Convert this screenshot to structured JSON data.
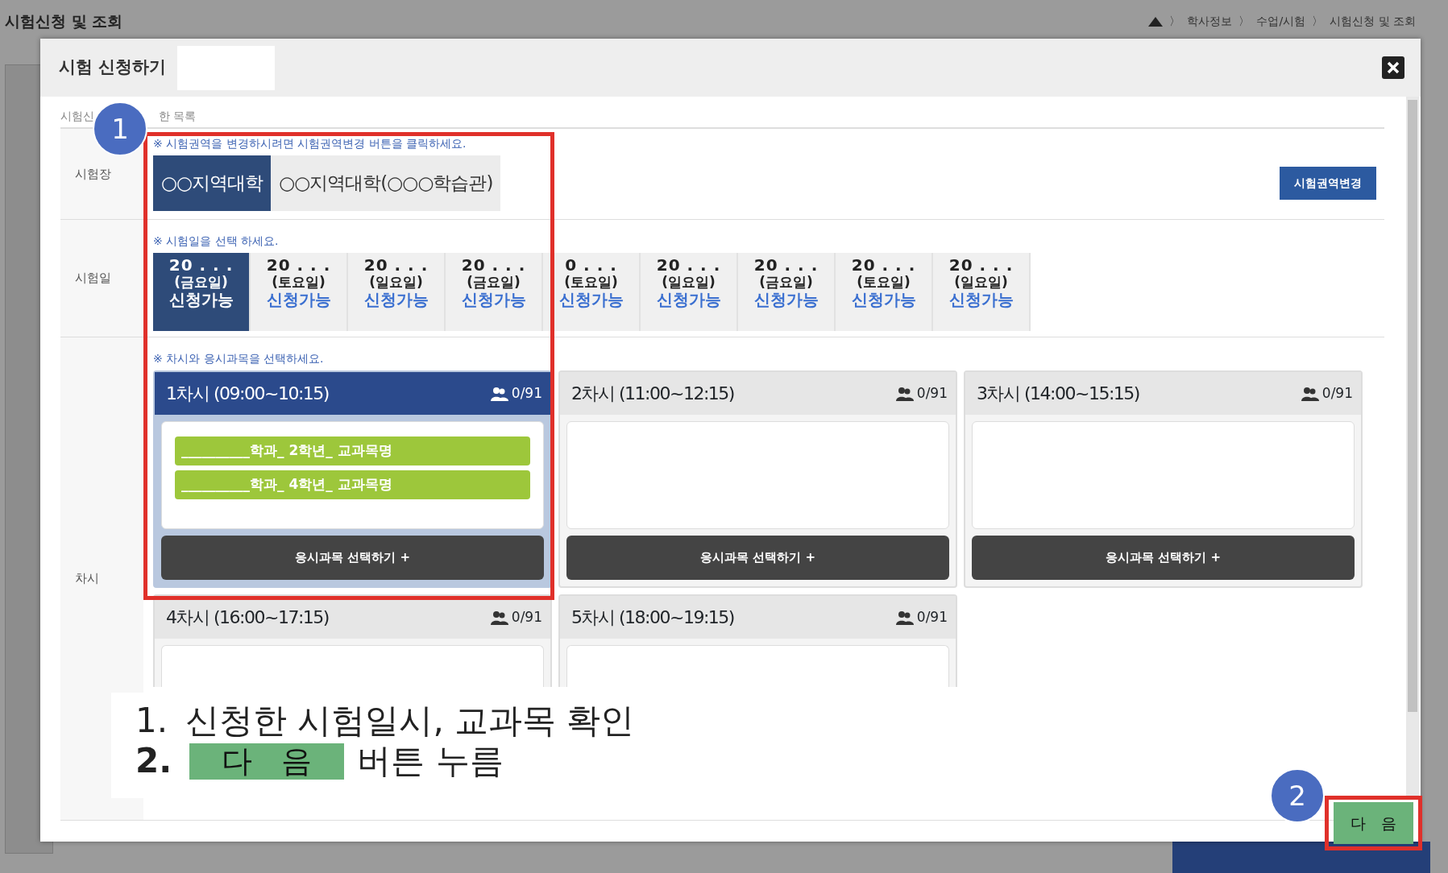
{
  "background_page": {
    "title": "시험신청 및 조회",
    "breadcrumb": [
      "학사정보",
      "수업/시험",
      "시험신청 및 조회"
    ],
    "separator": "〉"
  },
  "modal": {
    "title": "시험 신청하기",
    "section_label": [
      "시험신",
      "한 목록"
    ],
    "venue": {
      "label": "시험장",
      "notice": "※ 시험권역을 변경하시려면 시험권역변경 버튼을 클릭하세요.",
      "change_button": "시험권역변경",
      "options": [
        {
          "label": "○○지역대학",
          "selected": true
        },
        {
          "label": "○○지역대학(○○○학습관)",
          "selected": false
        }
      ]
    },
    "dates": {
      "label": "시험일",
      "notice": "※ 시험일을 선택 하세요.",
      "items": [
        {
          "date": "20 . . .",
          "weekday": "(금요일)",
          "status": "신청가능",
          "selected": true
        },
        {
          "date": "20 . . .",
          "weekday": "(토요일)",
          "status": "신청가능",
          "selected": false
        },
        {
          "date": "20 . . .",
          "weekday": "(일요일)",
          "status": "신청가능",
          "selected": false
        },
        {
          "date": "20 . . .",
          "weekday": "(금요일)",
          "status": "신청가능",
          "selected": false
        },
        {
          "date": "0 . . .",
          "weekday": "(토요일)",
          "status": "신청가능",
          "selected": false
        },
        {
          "date": "20 . . .",
          "weekday": "(일요일)",
          "status": "신청가능",
          "selected": false
        },
        {
          "date": "20 . . .",
          "weekday": "(금요일)",
          "status": "신청가능",
          "selected": false
        },
        {
          "date": "20 . . .",
          "weekday": "(토요일)",
          "status": "신청가능",
          "selected": false
        },
        {
          "date": "20 . . .",
          "weekday": "(일요일)",
          "status": "신청가능",
          "selected": false
        }
      ]
    },
    "sessions": {
      "label": "차시",
      "notice": "※ 차시와 응시과목을 선택하세요.",
      "items": [
        {
          "title": "1차시 (09:00~10:15)",
          "count": "0/91",
          "selected": true,
          "subjects": [
            "__________학과_ 2학년_ 교과목명",
            "__________학과_ 4학년_ 교과목명"
          ],
          "button": "응시과목 선택하기 +"
        },
        {
          "title": "2차시 (11:00~12:15)",
          "count": "0/91",
          "selected": false,
          "button": "응시과목 선택하기 +"
        },
        {
          "title": "3차시 (14:00~15:15)",
          "count": "0/91",
          "selected": false,
          "button": "응시과목 선택하기 +"
        },
        {
          "title": "4차시 (16:00~17:15)",
          "count": "0/91",
          "selected": false
        },
        {
          "title": "5차시 (18:00~19:15)",
          "count": "0/91",
          "selected": false
        }
      ]
    },
    "next_button": "다   음"
  },
  "annotations": {
    "markers": [
      "1",
      "2"
    ],
    "instructions": [
      {
        "number": "1.",
        "text": "신청한 시험일시, 교과목 확인"
      },
      {
        "number": "2.",
        "button": "다   음",
        "text": "버튼 누름"
      }
    ]
  }
}
